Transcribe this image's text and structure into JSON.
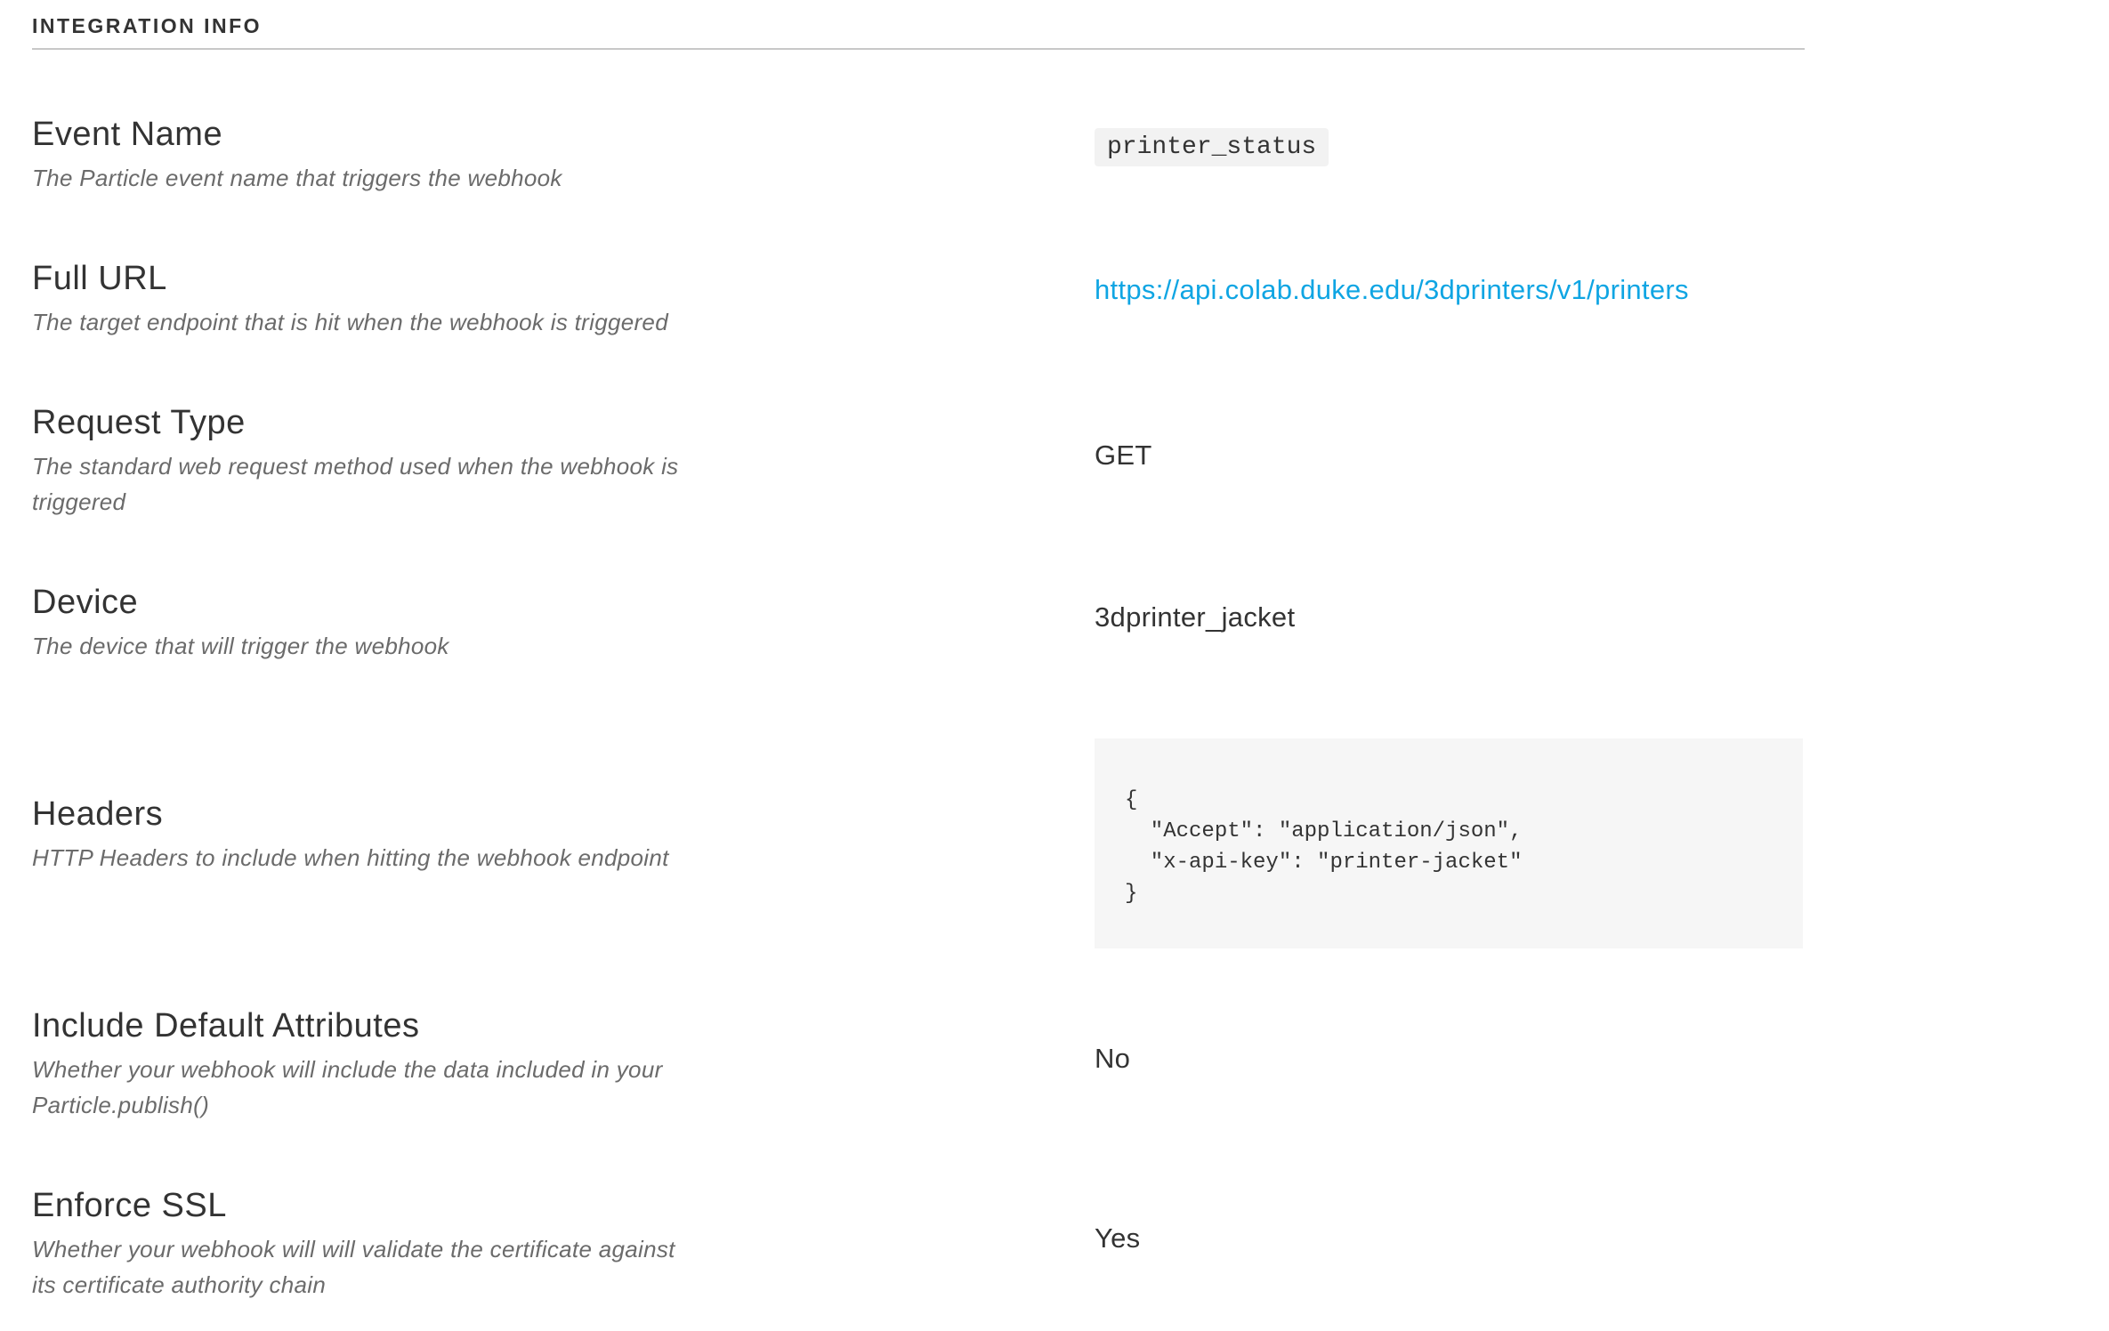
{
  "section": {
    "title": "INTEGRATION INFO"
  },
  "fields": {
    "event_name": {
      "label": "Event Name",
      "description": "The Particle event name that triggers the webhook",
      "value": "printer_status"
    },
    "full_url": {
      "label": "Full URL",
      "description": "The target endpoint that is hit when the webhook is triggered",
      "value": "https://api.colab.duke.edu/3dprinters/v1/printers"
    },
    "request_type": {
      "label": "Request Type",
      "description_lines": [
        "The standard web request method used when the webhook is",
        "triggered"
      ],
      "value": "GET"
    },
    "device": {
      "label": "Device",
      "description": "The device that will trigger the webhook",
      "value": "3dprinter_jacket"
    },
    "headers": {
      "label": "Headers",
      "description": "HTTP Headers to include when hitting the webhook endpoint",
      "code_lines": [
        "{",
        "  \"Accept\": \"application/json\",",
        "  \"x-api-key\": \"printer-jacket\"",
        "}"
      ]
    },
    "include_default_attributes": {
      "label": "Include Default Attributes",
      "description_lines": [
        "Whether your webhook will include the data included in your",
        "Particle.publish()"
      ],
      "value": "No"
    },
    "enforce_ssl": {
      "label": "Enforce SSL",
      "description_lines": [
        "Whether your webhook will will validate the certificate against",
        "its certificate authority chain"
      ],
      "value": "Yes"
    }
  }
}
